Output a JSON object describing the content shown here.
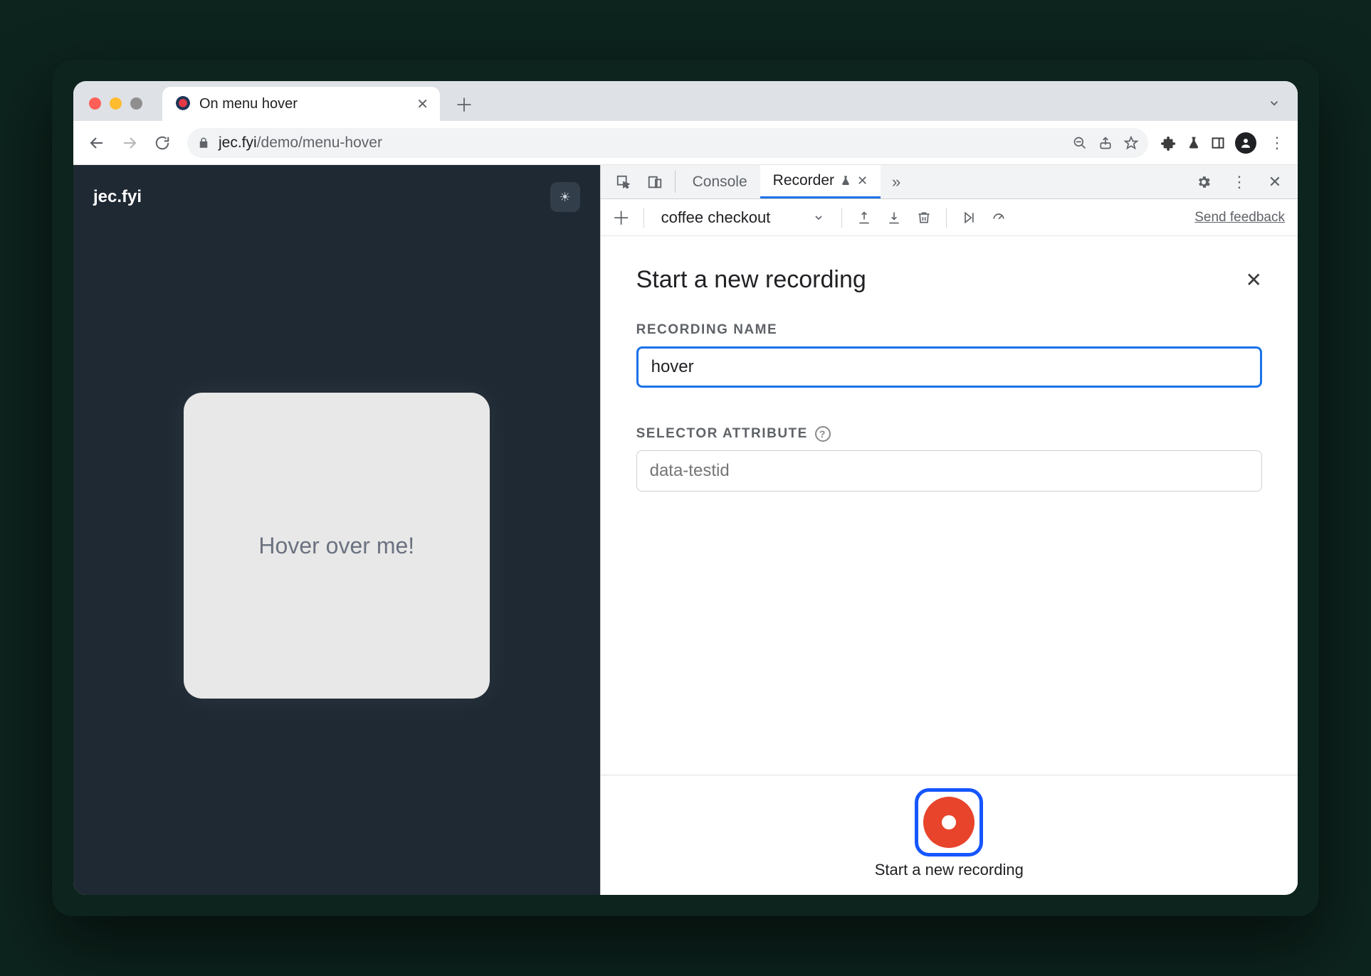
{
  "window": {
    "tab_title": "On menu hover",
    "url_host": "jec.fyi",
    "url_path": "/demo/menu-hover"
  },
  "page": {
    "logo": "jec.fyi",
    "hover_card_text": "Hover over me!"
  },
  "devtools": {
    "tabs": {
      "console": "Console",
      "recorder": "Recorder"
    },
    "toolbar": {
      "recording_select": "coffee checkout",
      "feedback": "Send feedback"
    },
    "panel": {
      "title": "Start a new recording",
      "recording_name_label": "RECORDING NAME",
      "recording_name_value": "hover",
      "selector_attr_label": "SELECTOR ATTRIBUTE",
      "selector_attr_placeholder": "data-testid",
      "record_button_label": "Start a new recording"
    }
  }
}
